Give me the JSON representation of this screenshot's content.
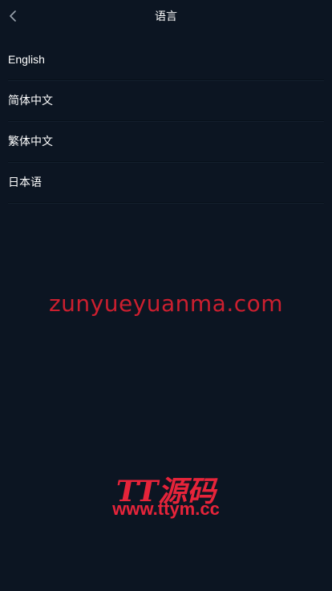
{
  "header": {
    "title": "语言"
  },
  "languages": [
    {
      "label": "English"
    },
    {
      "label": "简体中文"
    },
    {
      "label": "繁体中文"
    },
    {
      "label": "日本语"
    }
  ],
  "watermarks": {
    "primary": "zunyueyuanma.com",
    "brand": "TT源码",
    "url": "www.ttym.cc"
  },
  "colors": {
    "background": "#0c1522",
    "text": "#ffffff",
    "watermark": "#cc1f2f"
  }
}
